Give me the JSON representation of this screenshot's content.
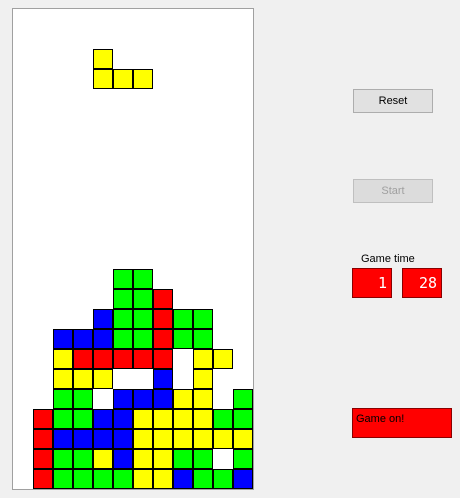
{
  "colors": {
    "Y": "#ffff00",
    "G": "#00ff00",
    "B": "#0000ff",
    "R": "#ff0000"
  },
  "board": {
    "cols": 12,
    "rows": 24,
    "falling_piece": {
      "color": "Y",
      "cells": [
        [
          4,
          2
        ],
        [
          4,
          3
        ],
        [
          5,
          3
        ],
        [
          6,
          3
        ]
      ]
    },
    "stack": [
      "............",
      "............",
      "............",
      "............",
      "............",
      "............",
      "............",
      "............",
      "............",
      "............",
      "............",
      "............",
      "............",
      ".....GG.....",
      ".....GGR....",
      "....BGGRGG..",
      "..BBBGGRGG..",
      "..YRRRRR.YY.",
      "..YYY..B.Y..",
      "..GG.BBBYY.G",
      ".RGGBBYYYYGG",
      ".RBBBBYYYYYY",
      ".RGGYBYYGG.G",
      ".RGGGGYYBGGB"
    ]
  },
  "controls": {
    "reset_label": "Reset",
    "start_label": "Start",
    "game_time_label": "Game time",
    "minutes": "1",
    "seconds": "28",
    "status_text": "Game on!"
  }
}
